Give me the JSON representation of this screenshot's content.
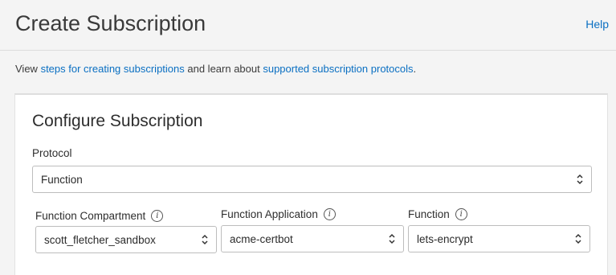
{
  "header": {
    "title": "Create Subscription",
    "help_label": "Help"
  },
  "intro": {
    "prefix": "View ",
    "link1": "steps for creating subscriptions",
    "middle": " and learn about ",
    "link2": "supported subscription protocols",
    "suffix": "."
  },
  "card": {
    "title": "Configure Subscription",
    "protocol": {
      "label": "Protocol",
      "value": "Function"
    },
    "compartment": {
      "label": "Function Compartment",
      "value": "scott_fletcher_sandbox"
    },
    "application": {
      "label": "Function Application",
      "value": "acme-certbot"
    },
    "function": {
      "label": "Function",
      "value": "lets-encrypt"
    }
  },
  "icons": {
    "info": "info-icon",
    "chevron": "chevron-up-down-icon"
  },
  "colors": {
    "link": "#0a6fc2",
    "background": "#f4f4f4",
    "card": "#ffffff"
  }
}
